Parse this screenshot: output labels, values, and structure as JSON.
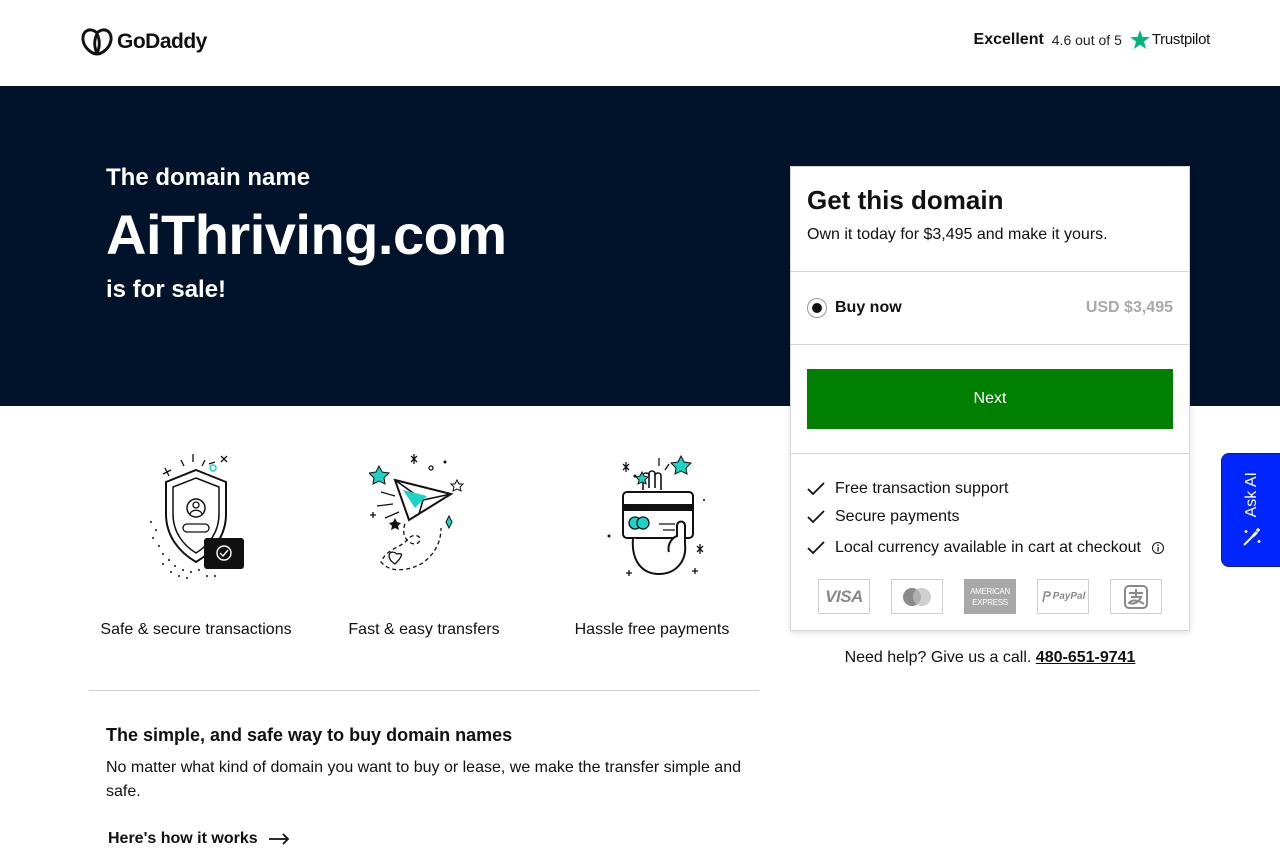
{
  "header": {
    "logo_text": "GoDaddy",
    "trustpilot": {
      "label": "Excellent",
      "rating": "4.6 out of 5",
      "brand": "Trustpilot"
    }
  },
  "hero": {
    "eyebrow": "The domain name",
    "domain": "AiThriving.com",
    "sale_text": "is for sale!"
  },
  "card": {
    "title": "Get this domain",
    "subtitle": "Own it today for $3,495 and make it yours.",
    "option_label": "Buy now",
    "option_price": "USD $3,495",
    "next_label": "Next",
    "features": [
      "Free transaction support",
      "Secure payments",
      "Local currency available in cart at checkout"
    ],
    "payments": {
      "visa": "VISA",
      "amex_line1": "AMERICAN",
      "amex_line2": "EXPRESS",
      "paypal": "PayPal"
    }
  },
  "help": {
    "text": "Need help? Give us a call.",
    "phone": "480-651-9741"
  },
  "tiles": [
    {
      "label": "Safe & secure transactions",
      "icon": "shield-icon"
    },
    {
      "label": "Fast & easy transfers",
      "icon": "paper-plane-icon"
    },
    {
      "label": "Hassle free payments",
      "icon": "card-payment-icon"
    }
  ],
  "info": {
    "title": "The simple, and safe way to buy domain names",
    "body": "No matter what kind of domain you want to buy or lease, we make the transfer simple and safe.",
    "link": "Here's how it works"
  },
  "ask_ai": {
    "label": "Ask AI"
  },
  "colors": {
    "hero_bg": "#00132b",
    "next_button": "#008000",
    "ask_ai": "#0025ff",
    "trustpilot_star": "#00b67a",
    "accent_teal": "#1bd4c7"
  }
}
